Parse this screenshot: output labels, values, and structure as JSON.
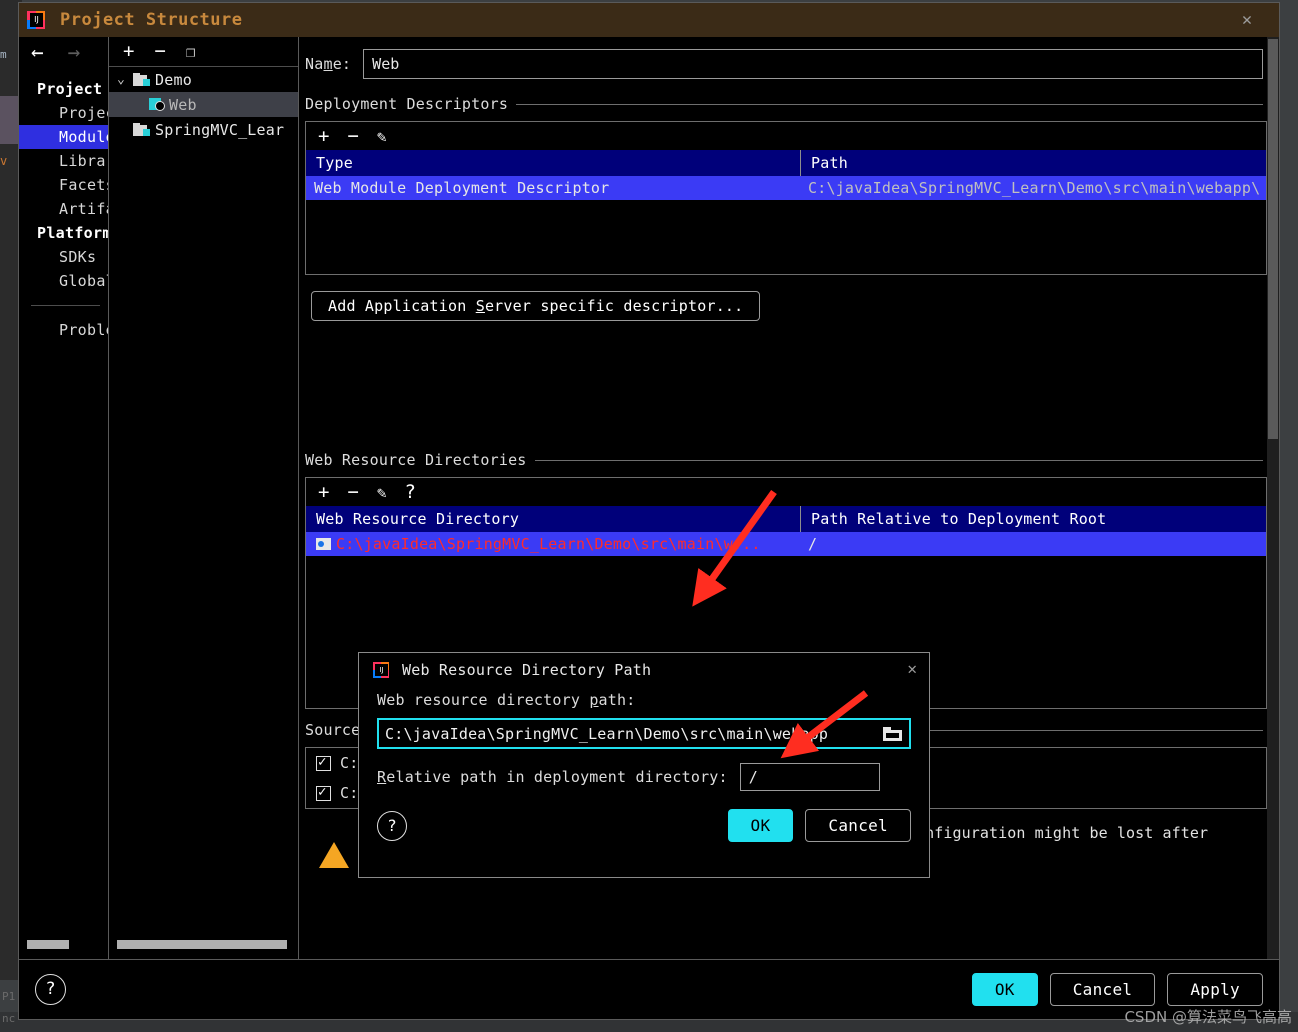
{
  "window": {
    "title": "Project Structure",
    "close_label": "✕",
    "logo_letters": "IJ"
  },
  "background": {
    "left_tab": "m",
    "left_orange": "v",
    "bottom_left_1": "P1",
    "bottom_left_2": "nc"
  },
  "nav": {
    "back_icon": "←",
    "forward_icon": "→",
    "groups": [
      {
        "header": "Project S",
        "items": [
          "Projec",
          "Module",
          "Librar",
          "Facets",
          "Artifa"
        ]
      },
      {
        "header": "Platform",
        "items": [
          "SDKs",
          "Global"
        ]
      }
    ],
    "selected": "Module",
    "footer_item": "Proble"
  },
  "tree": {
    "toolbar": {
      "add": "+",
      "remove": "−",
      "copy": "❐"
    },
    "nodes": [
      {
        "label": "Demo",
        "type": "folder",
        "chevron": "⌄",
        "indent": 0,
        "selected": false
      },
      {
        "label": "Web",
        "type": "module",
        "chevron": "",
        "indent": 1,
        "selected": true
      },
      {
        "label": "SpringMVC_Lear",
        "type": "folder",
        "chevron": "",
        "indent": 0,
        "selected": false
      }
    ]
  },
  "content": {
    "name_label_a": "Na",
    "name_label_b": "m",
    "name_label_c": "e:",
    "name_value": "Web",
    "deployment": {
      "title": "Deployment Descriptors",
      "toolbar": {
        "add": "+",
        "remove": "−",
        "edit": "✎"
      },
      "columns": [
        "Type",
        "Path"
      ],
      "rows": [
        {
          "type": "Web Module Deployment Descriptor",
          "path": "C:\\javaIdea\\SpringMVC_Learn\\Demo\\src\\main\\webapp\\",
          "path_tail": "a"
        }
      ]
    },
    "add_descriptor_button": {
      "pre": "Add Application ",
      "mnemonic": "S",
      "post": "erver specific descriptor..."
    },
    "web_resources": {
      "title": "Web Resource Directories",
      "toolbar": {
        "add": "+",
        "remove": "−",
        "edit": "✎",
        "help": "?"
      },
      "columns": [
        "Web Resource Directory",
        "Path Relative to Deployment Root"
      ],
      "rows": [
        {
          "directory": "C:\\javaIdea\\SpringMVC_Learn\\Demo\\src\\main\\w...",
          "relative": "/",
          "error": true
        }
      ]
    },
    "source_roots": {
      "title": "Source",
      "rows": [
        {
          "path": "C:",
          "checked": true
        },
        {
          "path": "C:\\javaIdea\\SpringMVC_Learn\\Demo\\src\\main\\resources",
          "checked": true
        }
      ]
    },
    "warning": "Facet 'Web' is imported from Maven. Any changes made in its configuration might be lost after reimporting."
  },
  "footer": {
    "help_icon": "?",
    "ok": "OK",
    "cancel": "Cancel",
    "apply": "Apply"
  },
  "modal": {
    "title": "Web Resource Directory Path",
    "close_label": "✕",
    "path_label_a": "Web resource directory ",
    "path_label_mnemonic": "p",
    "path_label_b": "ath:",
    "path_value": "C:\\javaIdea\\SpringMVC_Learn\\Demo\\src\\main\\webapp",
    "browse_icon": "folder-open-icon",
    "relative_label_mnemonic": "R",
    "relative_label_rest": "elative path in deployment directory:",
    "relative_value": "/",
    "help_icon": "?",
    "ok": "OK",
    "cancel": "Cancel"
  },
  "watermark": "CSDN @算法菜鸟飞高高",
  "colors": {
    "title_bar": "#3b2b17",
    "title_text": "#c8893d",
    "selection_blue": "#2f2fe0",
    "table_header_blue": "#00007a",
    "table_row_blue": "#3b3bf5",
    "accent_cyan": "#21e0ef",
    "error_red": "#ff2b2b",
    "warning_amber": "#f5a623",
    "arrow_red": "#ff2d20"
  }
}
